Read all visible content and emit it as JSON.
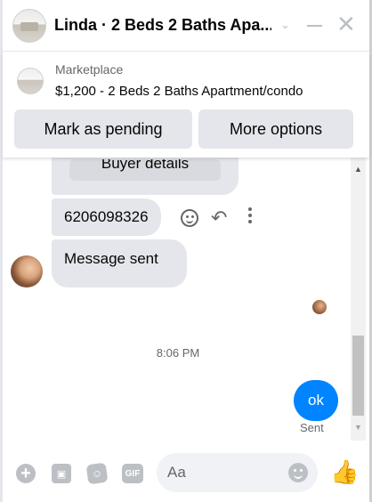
{
  "header": {
    "title": "Linda · 2 Beds 2 Baths Apa...",
    "chevron_icon": "chevron-down-icon",
    "minimize_icon": "minimize-icon",
    "close_icon": "close-icon"
  },
  "marketplace": {
    "label": "Marketplace",
    "listing": "$1,200 - 2 Beds 2 Baths Apartment/condo",
    "pending_button": "Mark as pending",
    "more_button": "More options"
  },
  "messages": {
    "buyer_details": "Buyer details",
    "phone": "6206098326",
    "sent_text": "Message sent",
    "time": "8:06 PM",
    "ok_text": "ok",
    "sent_status": "Sent",
    "accent_color": "#0084ff"
  },
  "composer": {
    "placeholder": "Aa",
    "gif_label": "GIF"
  }
}
